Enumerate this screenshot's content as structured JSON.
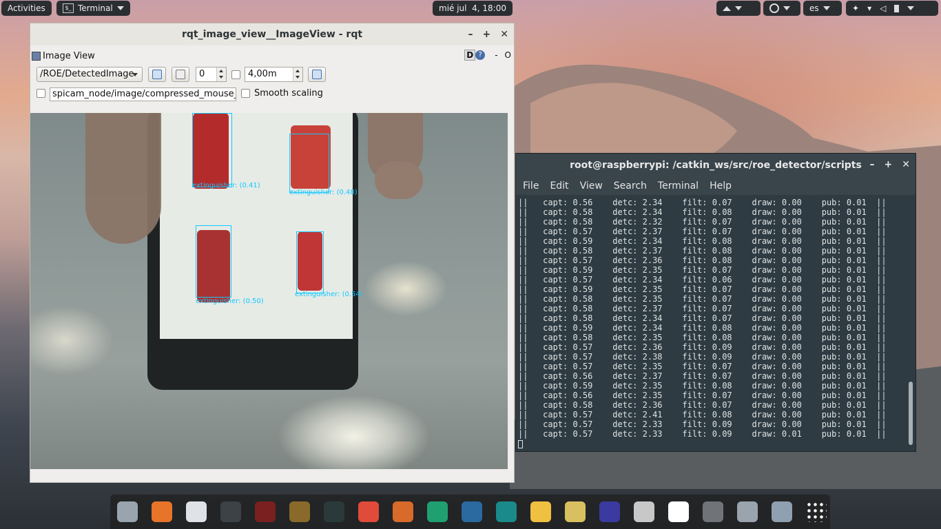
{
  "topbar": {
    "activities": "Activities",
    "app_menu": "Terminal",
    "clock": "mié jul  4, 18:00",
    "lang": "es"
  },
  "rqt_window": {
    "title": "rqt_image_view__ImageView - rqt",
    "plugin_title": "Image View",
    "hdr_d": "D",
    "hdr_help": "?",
    "hdr_minus": "-",
    "hdr_close": "O",
    "topic": "/ROE/DetectedImage",
    "spin_value": "0",
    "max_range": "4,00m",
    "mouse_topic": "spicam_node/image/compressed_mouse_left",
    "smooth_scaling_label": "Smooth scaling",
    "smooth_scaling_checked": false,
    "detections": [
      {
        "label": "extinguisher: (0.41)"
      },
      {
        "label": "extinguisher: (0.48)"
      },
      {
        "label": "extinguisher: (0.50)"
      },
      {
        "label": "extinguisher: (0.54)"
      }
    ]
  },
  "terminal": {
    "title": "root@raspberrypi: /catkin_ws/src/roe_detector/scripts",
    "menu": [
      "File",
      "Edit",
      "View",
      "Search",
      "Terminal",
      "Help"
    ],
    "lines": [
      [
        "0.56",
        "2.34",
        "0.07",
        "0.00",
        "0.01"
      ],
      [
        "0.58",
        "2.34",
        "0.08",
        "0.00",
        "0.01"
      ],
      [
        "0.58",
        "2.32",
        "0.07",
        "0.00",
        "0.01"
      ],
      [
        "0.57",
        "2.37",
        "0.07",
        "0.00",
        "0.01"
      ],
      [
        "0.59",
        "2.34",
        "0.08",
        "0.00",
        "0.01"
      ],
      [
        "0.58",
        "2.37",
        "0.08",
        "0.00",
        "0.01"
      ],
      [
        "0.57",
        "2.36",
        "0.08",
        "0.00",
        "0.01"
      ],
      [
        "0.59",
        "2.35",
        "0.07",
        "0.00",
        "0.01"
      ],
      [
        "0.57",
        "2.34",
        "0.06",
        "0.00",
        "0.01"
      ],
      [
        "0.59",
        "2.35",
        "0.07",
        "0.00",
        "0.01"
      ],
      [
        "0.58",
        "2.35",
        "0.07",
        "0.00",
        "0.01"
      ],
      [
        "0.58",
        "2.37",
        "0.07",
        "0.00",
        "0.01"
      ],
      [
        "0.58",
        "2.34",
        "0.07",
        "0.00",
        "0.01"
      ],
      [
        "0.59",
        "2.34",
        "0.08",
        "0.00",
        "0.01"
      ],
      [
        "0.58",
        "2.35",
        "0.08",
        "0.00",
        "0.01"
      ],
      [
        "0.57",
        "2.36",
        "0.09",
        "0.00",
        "0.01"
      ],
      [
        "0.57",
        "2.38",
        "0.09",
        "0.00",
        "0.01"
      ],
      [
        "0.57",
        "2.35",
        "0.07",
        "0.00",
        "0.01"
      ],
      [
        "0.56",
        "2.37",
        "0.07",
        "0.00",
        "0.01"
      ],
      [
        "0.59",
        "2.35",
        "0.08",
        "0.00",
        "0.01"
      ],
      [
        "0.56",
        "2.35",
        "0.07",
        "0.00",
        "0.01"
      ],
      [
        "0.58",
        "2.36",
        "0.07",
        "0.00",
        "0.01"
      ],
      [
        "0.57",
        "2.41",
        "0.08",
        "0.00",
        "0.01"
      ],
      [
        "0.57",
        "2.33",
        "0.09",
        "0.00",
        "0.01"
      ],
      [
        "0.57",
        "2.33",
        "0.09",
        "0.01",
        "0.01"
      ]
    ]
  },
  "dock": {
    "apps": [
      "files-icon",
      "firefox-icon",
      "chrome-icon",
      "terminal-icon",
      "terminal-red-icon",
      "sublime-icon",
      "inkscape-icon",
      "git-icon",
      "matlab-icon",
      "pycharm-icon",
      "monitor-icon",
      "arduino-icon",
      "mail-icon",
      "rhythmbox-icon",
      "headphones-icon",
      "earth-pro-icon",
      "document-icon",
      "calculator-icon",
      "screenshot-icon",
      "image-viewer-icon",
      "app-grid-icon"
    ]
  }
}
